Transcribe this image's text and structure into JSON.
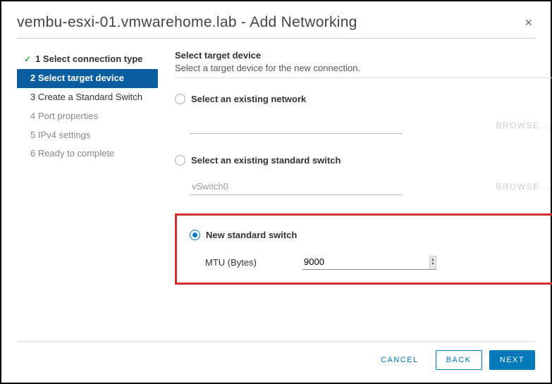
{
  "header": {
    "title": "vembu-esxi-01.vmwarehome.lab - Add Networking",
    "close": "×"
  },
  "sidebar": {
    "steps": [
      {
        "num": "1",
        "label": "Select connection type"
      },
      {
        "num": "2",
        "label": "Select target device"
      },
      {
        "num": "3",
        "label": "Create a Standard Switch"
      },
      {
        "num": "4",
        "label": "Port properties"
      },
      {
        "num": "5",
        "label": "IPv4 settings"
      },
      {
        "num": "6",
        "label": "Ready to complete"
      }
    ]
  },
  "content": {
    "title": "Select target device",
    "subtitle": "Select a target device for the new connection.",
    "option_existing_network": "Select an existing network",
    "option_existing_switch": "Select an existing standard switch",
    "switch_value": "vSwitch0",
    "browse": "BROWSE …",
    "option_new_switch": "New standard switch",
    "mtu_label": "MTU (Bytes)",
    "mtu_value": "9000"
  },
  "footer": {
    "cancel": "CANCEL",
    "back": "BACK",
    "next": "NEXT"
  }
}
